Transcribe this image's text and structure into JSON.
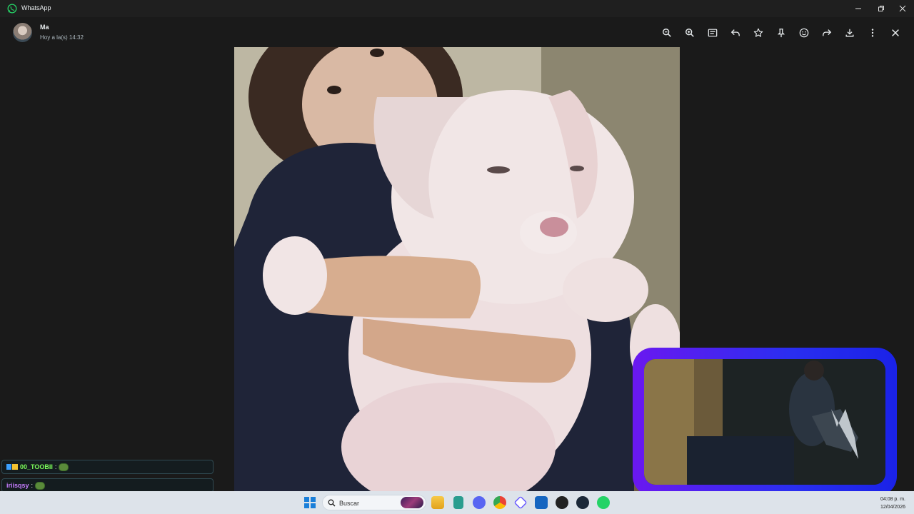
{
  "window": {
    "title": "WhatsApp"
  },
  "viewer": {
    "contact_name": "Ma",
    "timestamp": "Hoy a la(s) 14:32",
    "toolbar": [
      {
        "icon": "zoom-out-icon"
      },
      {
        "icon": "zoom-in-icon"
      },
      {
        "icon": "message-icon"
      },
      {
        "icon": "reply-icon"
      },
      {
        "icon": "star-icon"
      },
      {
        "icon": "pin-icon"
      },
      {
        "icon": "emoji-icon"
      },
      {
        "icon": "forward-icon"
      },
      {
        "icon": "download-icon"
      },
      {
        "icon": "more-icon"
      },
      {
        "icon": "close-icon"
      }
    ]
  },
  "chat_overlay": [
    {
      "user": "00_TOOBII",
      "color": "#7cff5a"
    },
    {
      "user": "iriisqsy",
      "color": "#c77dff"
    },
    {
      "user": "",
      "color": "#8a4dff"
    }
  ],
  "taskbar": {
    "search_label": "Buscar",
    "time": "04:08 p. m.",
    "date": "12/04/2026"
  },
  "colors": {
    "whatsapp_green": "#25d366",
    "cam_border": "#4a22f0"
  }
}
